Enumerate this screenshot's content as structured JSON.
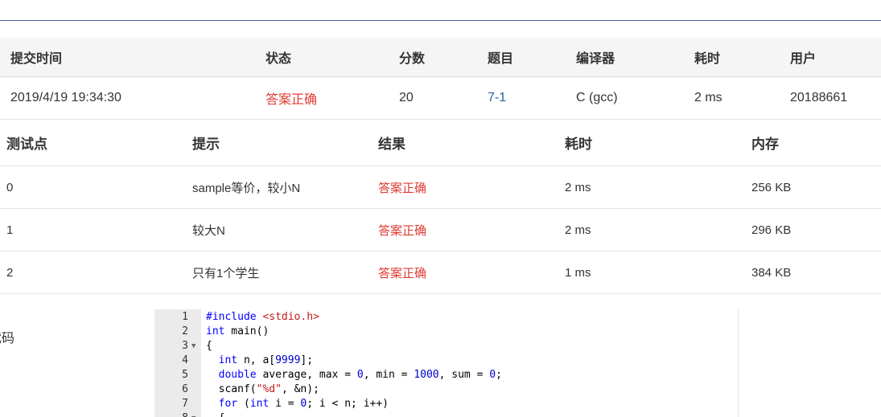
{
  "submission": {
    "headers": [
      "提交时间",
      "状态",
      "分数",
      "题目",
      "编译器",
      "耗时",
      "用户"
    ],
    "row": {
      "time": "2019/4/19 19:34:30",
      "status": "答案正确",
      "score": "20",
      "problem": "7-1",
      "compiler": "C (gcc)",
      "elapsed": "2 ms",
      "user": "20188661"
    }
  },
  "test_points": {
    "headers": [
      "测试点",
      "提示",
      "结果",
      "耗时",
      "内存"
    ],
    "rows": [
      {
        "id": "0",
        "hint": "sample等价，较小N",
        "result": "答案正确",
        "time": "2 ms",
        "memory": "256 KB"
      },
      {
        "id": "1",
        "hint": "较大N",
        "result": "答案正确",
        "time": "2 ms",
        "memory": "296 KB"
      },
      {
        "id": "2",
        "hint": "只有1个学生",
        "result": "答案正确",
        "time": "1 ms",
        "memory": "384 KB"
      }
    ]
  },
  "code_section_label": "代码",
  "code_lines": [
    {
      "n": "1",
      "fold": false
    },
    {
      "n": "2",
      "fold": false
    },
    {
      "n": "3",
      "fold": true
    },
    {
      "n": "4",
      "fold": false
    },
    {
      "n": "5",
      "fold": false
    },
    {
      "n": "6",
      "fold": false
    },
    {
      "n": "7",
      "fold": false
    },
    {
      "n": "8",
      "fold": true
    }
  ],
  "code_text": {
    "l1_kw": "#include",
    "l1_str": "<stdio.h>",
    "l2_kw": "int",
    "l2_rest": " main()",
    "l3": "{",
    "l4_kw": "int",
    "l4_rest": " n, a[",
    "l4_num": "9999",
    "l4_end": "];",
    "l5_kw": "double",
    "l5_a": " average, max = ",
    "l5_n1": "0",
    "l5_b": ", min = ",
    "l5_n2": "1000",
    "l5_c": ", sum = ",
    "l5_n3": "0",
    "l5_d": ";",
    "l6_a": "scanf(",
    "l6_str": "\"%d\"",
    "l6_b": ", &n);",
    "l7_kw": "for",
    "l7_a": " (",
    "l7_kw2": "int",
    "l7_b": " i = ",
    "l7_n": "0",
    "l7_c": "; i < n; i++)",
    "l8": "{"
  },
  "colors": {
    "accent": "#3f6ba6",
    "correct": "#e03b33",
    "link": "#2c5fa5"
  }
}
